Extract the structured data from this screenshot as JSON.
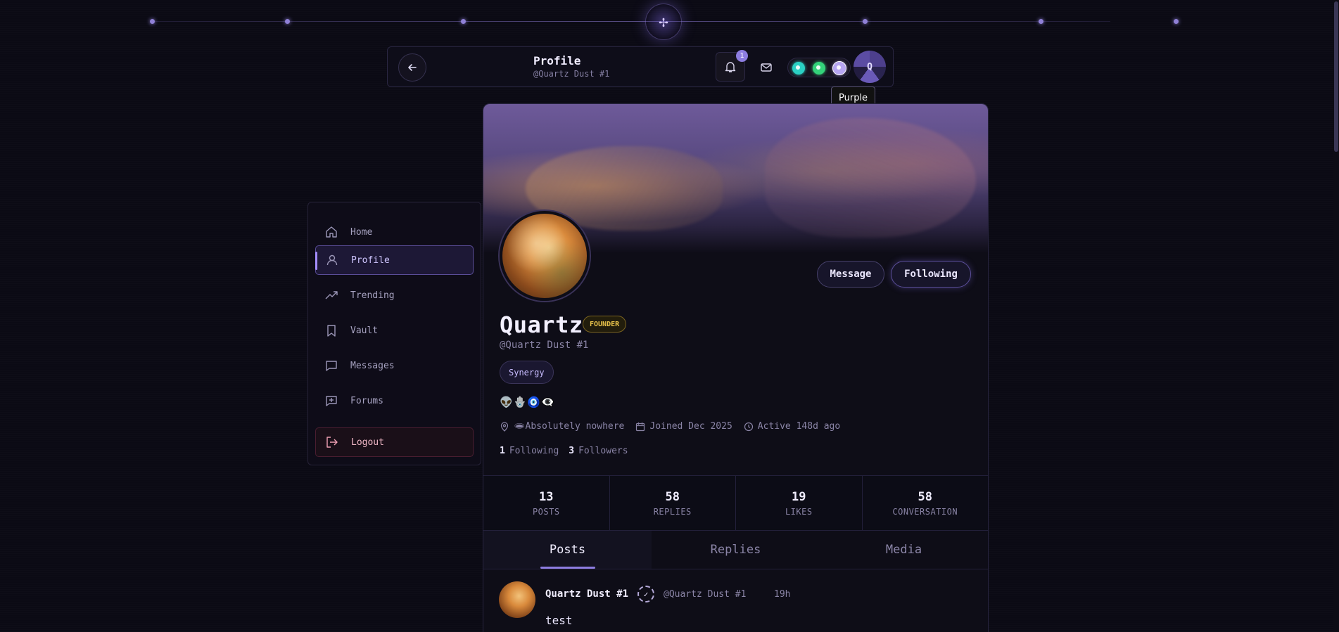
{
  "header": {
    "title": "Profile",
    "subtitle": "@Quartz Dust #1",
    "notification_count": "1",
    "avatar_initial": "Q",
    "theme_swatches": [
      "#2bd1c4",
      "#34d27a",
      "#b7a6f2"
    ],
    "tooltip": "Purple"
  },
  "sidebar": {
    "items": [
      {
        "label": "Home",
        "icon": "home-icon"
      },
      {
        "label": "Profile",
        "icon": "user-icon",
        "active": true
      },
      {
        "label": "Trending",
        "icon": "trending-icon"
      },
      {
        "label": "Vault",
        "icon": "bookmark-icon"
      },
      {
        "label": "Messages",
        "icon": "message-icon"
      },
      {
        "label": "Forums",
        "icon": "forum-icon"
      }
    ],
    "logout_label": "Logout"
  },
  "profile": {
    "name": "Quartz",
    "badge": "FOUNDER",
    "handle": "@Quartz Dust #1",
    "chip": "Synergy",
    "emojis": "👽🪬🧿👁‍🗨",
    "location": "🕳Absolutely nowhere",
    "joined": "Joined Dec 2025",
    "active": "Active 148d ago",
    "following_count": "1",
    "following_label": "Following",
    "followers_count": "3",
    "followers_label": "Followers",
    "message_button": "Message",
    "following_button": "Following"
  },
  "stats": [
    {
      "value": "13",
      "label": "POSTS"
    },
    {
      "value": "58",
      "label": "REPLIES"
    },
    {
      "value": "19",
      "label": "LIKES"
    },
    {
      "value": "58",
      "label": "CONVERSATION"
    }
  ],
  "tabs": [
    {
      "label": "Posts",
      "active": true
    },
    {
      "label": "Replies"
    },
    {
      "label": "Media"
    }
  ],
  "post": {
    "author": "Quartz Dust #1",
    "handle": "@Quartz Dust #1",
    "time": "19h",
    "body": "test"
  },
  "colors": {
    "accent": "#8d7de0",
    "founder": "#e8c24a",
    "background": "#0b0a14"
  }
}
